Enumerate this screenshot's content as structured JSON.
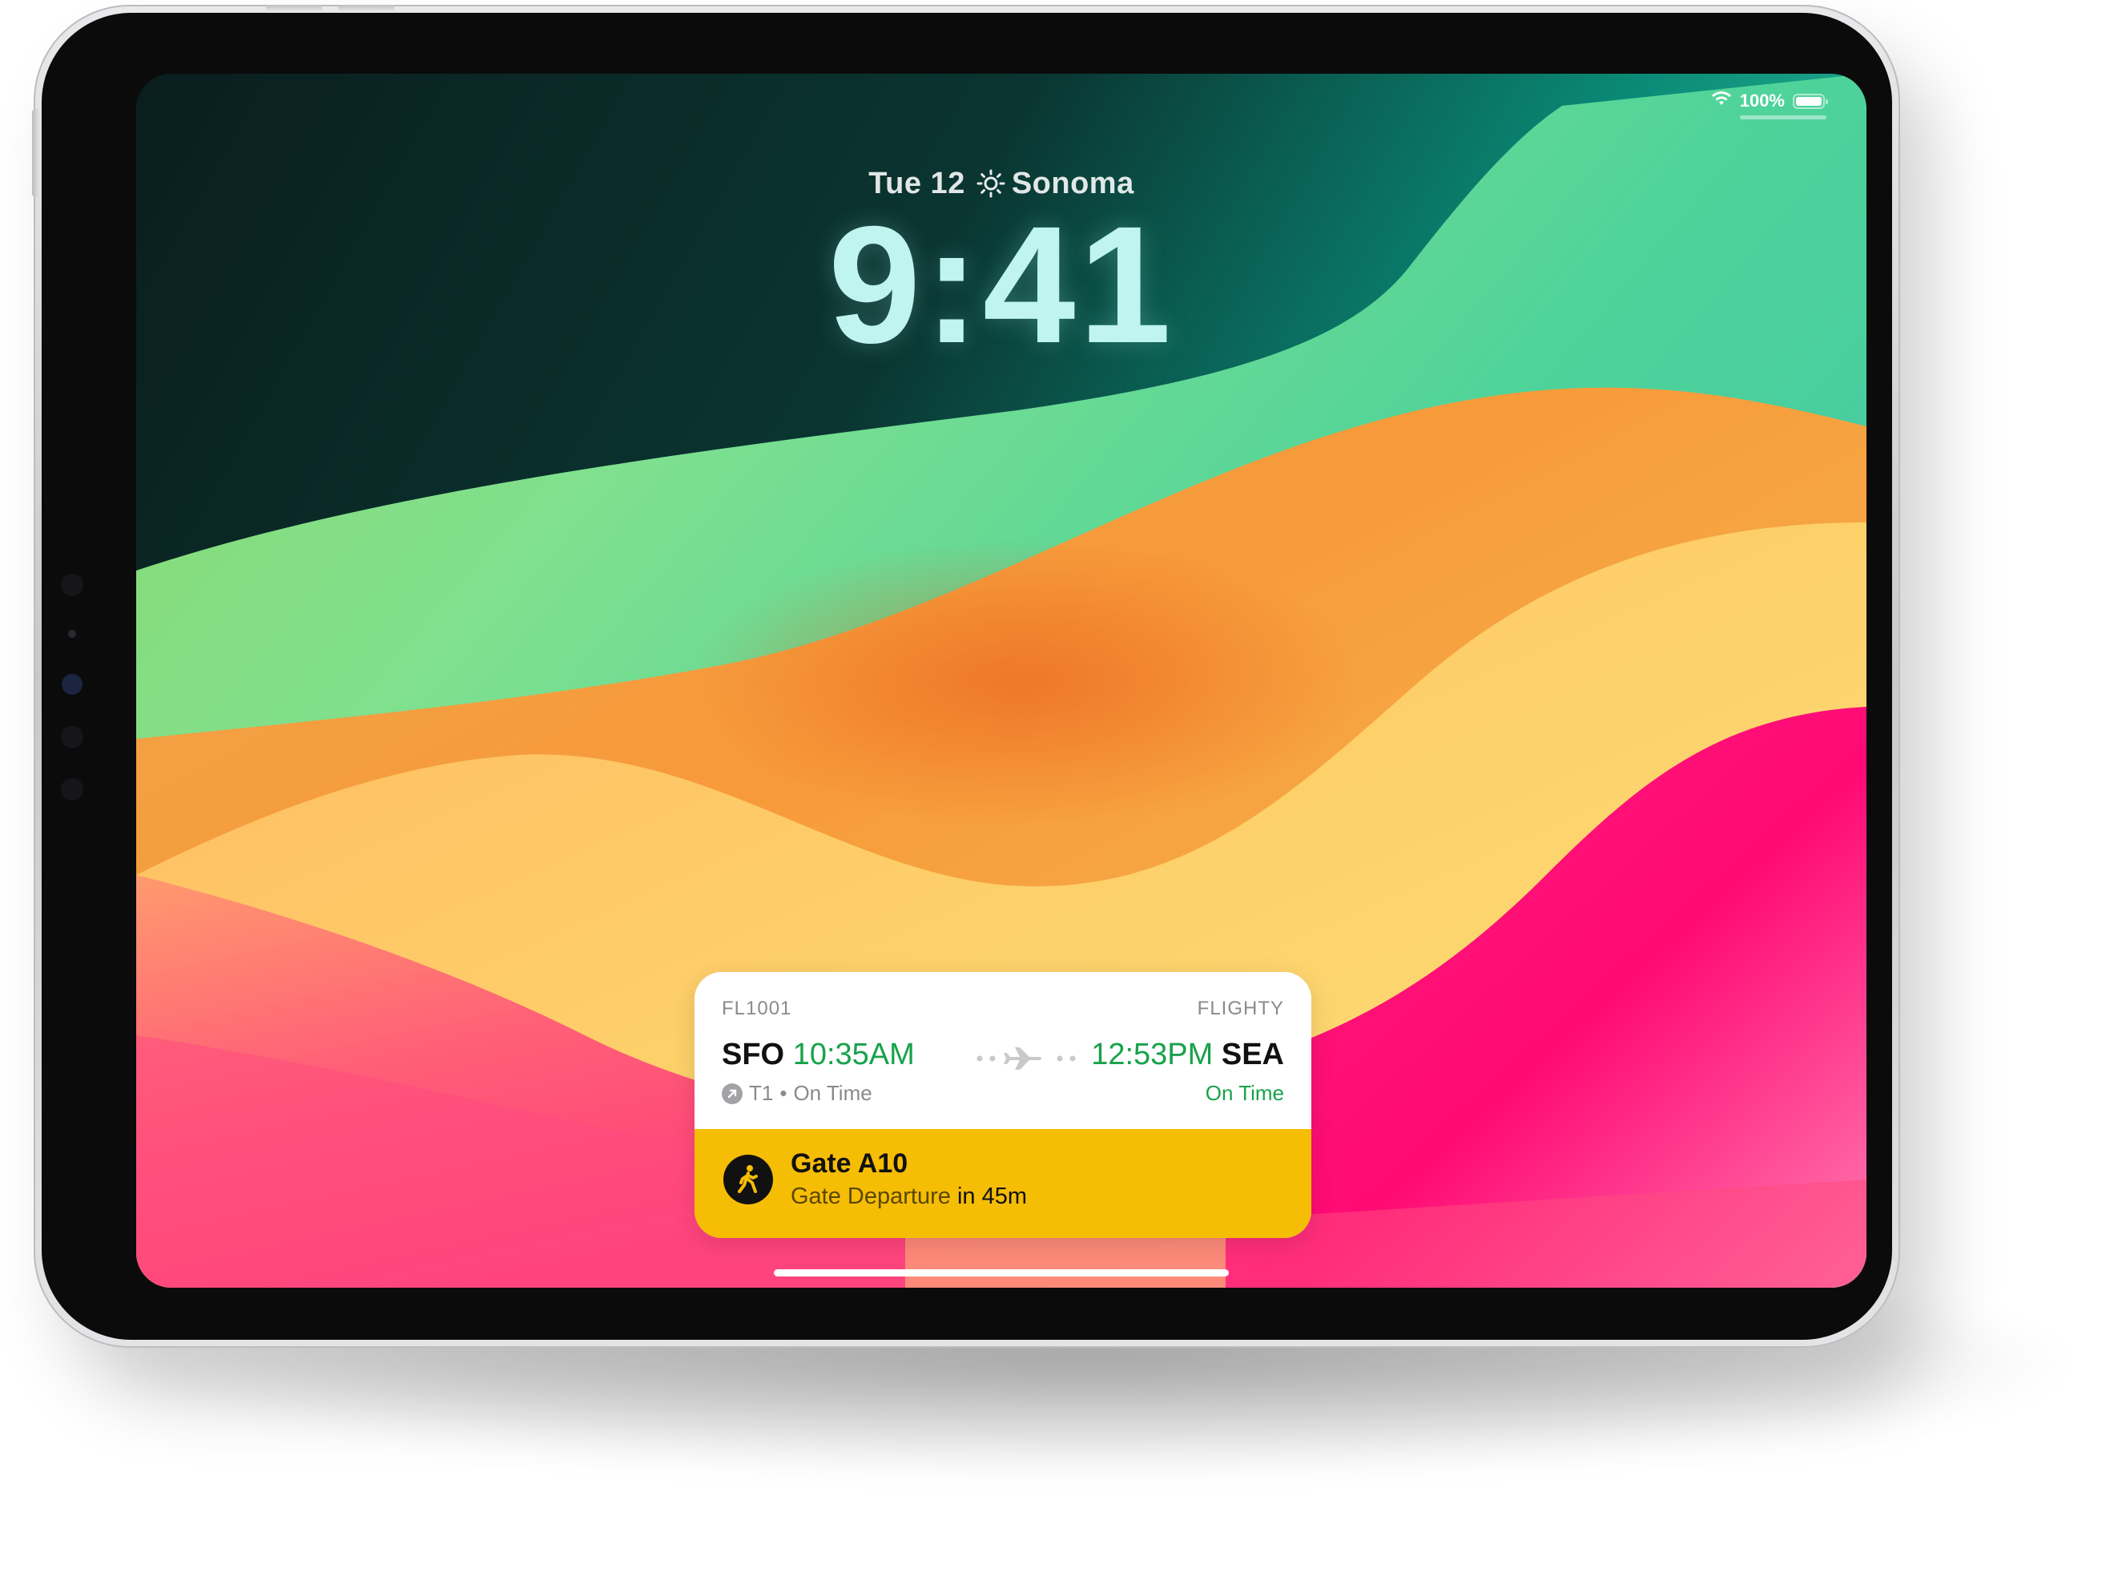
{
  "status_bar": {
    "battery_text": "100%",
    "battery_level": 1.0,
    "wifi_icon": "wifi-icon",
    "battery_icon": "battery-icon"
  },
  "lock_screen": {
    "date": "Tue 12",
    "weather_icon": "sun-icon",
    "location": "Sonoma",
    "time": "9:41"
  },
  "live_activity": {
    "flight_number": "FL1001",
    "app_name": "FLIGHTY",
    "departure": {
      "code": "SFO",
      "time": "10:35AM",
      "terminal": "T1",
      "separator": "•",
      "status": "On Time"
    },
    "arrival": {
      "code": "SEA",
      "time": "12:53PM",
      "status": "On Time"
    },
    "gate": {
      "title": "Gate A10",
      "label": "Gate Departure",
      "countdown": "in 45m",
      "icon": "walking-person-icon"
    }
  },
  "colors": {
    "status_green": "#17a24a",
    "gate_banner": "#f6bd05",
    "clock_tint": "#bff4ef"
  }
}
